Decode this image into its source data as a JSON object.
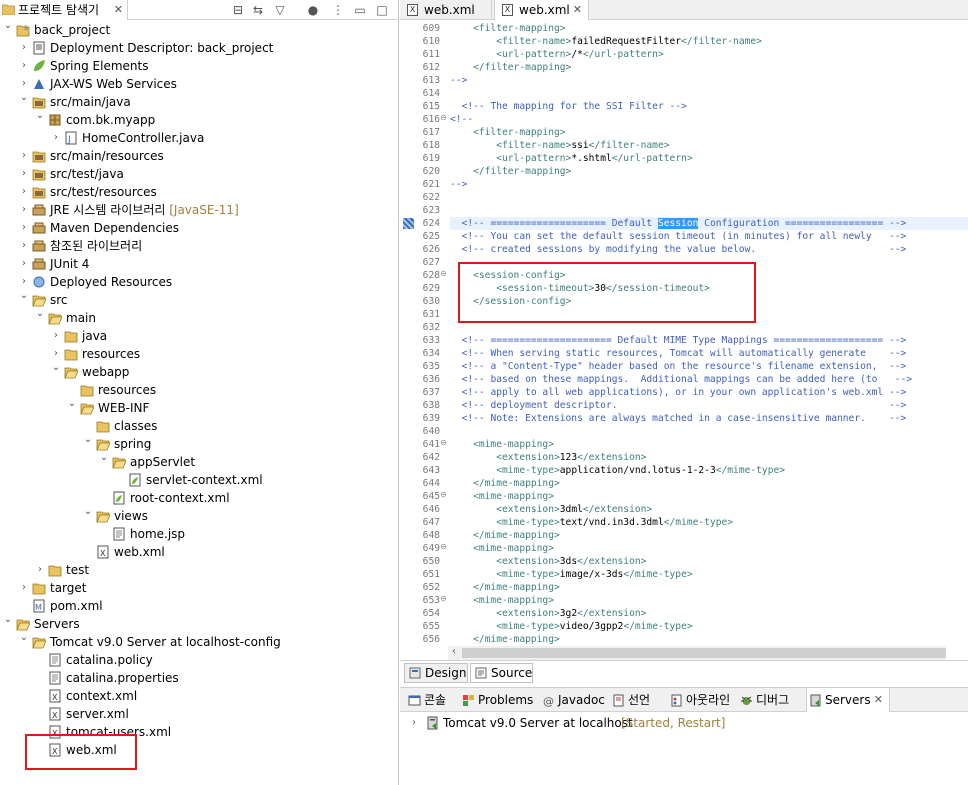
{
  "left_panel": {
    "tab_title": "프로젝트 탐색기",
    "close": "✕",
    "tree": [
      {
        "label": "back_project",
        "decor": ""
      },
      {
        "label": "Deployment Descriptor: back_project",
        "decor": ""
      },
      {
        "label": "Spring Elements",
        "decor": ""
      },
      {
        "label": "JAX-WS Web Services",
        "decor": ""
      },
      {
        "label": "src/main/java",
        "decor": ""
      },
      {
        "label": "com.bk.myapp",
        "decor": ""
      },
      {
        "label": "HomeController.java",
        "decor": ""
      },
      {
        "label": "src/main/resources",
        "decor": ""
      },
      {
        "label": "src/test/java",
        "decor": ""
      },
      {
        "label": "src/test/resources",
        "decor": ""
      },
      {
        "label": "JRE 시스템 라이브러리",
        "decor": "[JavaSE-11]"
      },
      {
        "label": "Maven Dependencies",
        "decor": ""
      },
      {
        "label": "참조된 라이브러리",
        "decor": ""
      },
      {
        "label": "JUnit 4",
        "decor": ""
      },
      {
        "label": "Deployed Resources",
        "decor": ""
      },
      {
        "label": "src",
        "decor": ""
      },
      {
        "label": "main",
        "decor": ""
      },
      {
        "label": "java",
        "decor": ""
      },
      {
        "label": "resources",
        "decor": ""
      },
      {
        "label": "webapp",
        "decor": ""
      },
      {
        "label": "resources",
        "decor": ""
      },
      {
        "label": "WEB-INF",
        "decor": ""
      },
      {
        "label": "classes",
        "decor": ""
      },
      {
        "label": "spring",
        "decor": ""
      },
      {
        "label": "appServlet",
        "decor": ""
      },
      {
        "label": "servlet-context.xml",
        "decor": ""
      },
      {
        "label": "root-context.xml",
        "decor": ""
      },
      {
        "label": "views",
        "decor": ""
      },
      {
        "label": "home.jsp",
        "decor": ""
      },
      {
        "label": "web.xml",
        "decor": ""
      },
      {
        "label": "test",
        "decor": ""
      },
      {
        "label": "target",
        "decor": ""
      },
      {
        "label": "pom.xml",
        "decor": ""
      },
      {
        "label": "Servers",
        "decor": ""
      },
      {
        "label": "Tomcat v9.0 Server at localhost-config",
        "decor": ""
      },
      {
        "label": "catalina.policy",
        "decor": ""
      },
      {
        "label": "catalina.properties",
        "decor": ""
      },
      {
        "label": "context.xml",
        "decor": ""
      },
      {
        "label": "server.xml",
        "decor": ""
      },
      {
        "label": "tomcat-users.xml",
        "decor": ""
      },
      {
        "label": "web.xml",
        "decor": ""
      }
    ]
  },
  "editor": {
    "tabs": [
      {
        "label": "web.xml"
      },
      {
        "label": "web.xml",
        "close": "✕"
      }
    ],
    "lines": [
      {
        "n": "609",
        "t": "    <filter-mapping>"
      },
      {
        "n": "610",
        "t": "        <filter-name>failedRequestFilter</filter-name>"
      },
      {
        "n": "611",
        "t": "        <url-pattern>/*</url-pattern>"
      },
      {
        "n": "612",
        "t": "    </filter-mapping>"
      },
      {
        "n": "613",
        "t": "-->"
      },
      {
        "n": "614",
        "t": ""
      },
      {
        "n": "615",
        "t": "  <!-- The mapping for the SSI Filter -->"
      },
      {
        "n": "616",
        "t": "<!--"
      },
      {
        "n": "617",
        "t": "    <filter-mapping>"
      },
      {
        "n": "618",
        "t": "        <filter-name>ssi</filter-name>"
      },
      {
        "n": "619",
        "t": "        <url-pattern>*.shtml</url-pattern>"
      },
      {
        "n": "620",
        "t": "    </filter-mapping>"
      },
      {
        "n": "621",
        "t": "-->"
      },
      {
        "n": "622",
        "t": ""
      },
      {
        "n": "623",
        "t": ""
      },
      {
        "n": "624",
        "t": "  <!-- ==================== Default Session Configuration ================= -->"
      },
      {
        "n": "625",
        "t": "  <!-- You can set the default session timeout (in minutes) for all newly   -->"
      },
      {
        "n": "626",
        "t": "  <!-- created sessions by modifying the value below.                       -->"
      },
      {
        "n": "627",
        "t": ""
      },
      {
        "n": "628",
        "t": "    <session-config>"
      },
      {
        "n": "629",
        "t": "        <session-timeout>30</session-timeout>"
      },
      {
        "n": "630",
        "t": "    </session-config>"
      },
      {
        "n": "631",
        "t": ""
      },
      {
        "n": "632",
        "t": ""
      },
      {
        "n": "633",
        "t": "  <!-- ===================== Default MIME Type Mappings =================== -->"
      },
      {
        "n": "634",
        "t": "  <!-- When serving static resources, Tomcat will automatically generate    -->"
      },
      {
        "n": "635",
        "t": "  <!-- a \"Content-Type\" header based on the resource's filename extension,  -->"
      },
      {
        "n": "636",
        "t": "  <!-- based on these mappings.  Additional mappings can be added here (to   -->"
      },
      {
        "n": "637",
        "t": "  <!-- apply to all web applications), or in your own application's web.xml -->"
      },
      {
        "n": "638",
        "t": "  <!-- deployment descriptor.                                               -->"
      },
      {
        "n": "639",
        "t": "  <!-- Note: Extensions are always matched in a case-insensitive manner.    -->"
      },
      {
        "n": "640",
        "t": ""
      },
      {
        "n": "641",
        "t": "    <mime-mapping>"
      },
      {
        "n": "642",
        "t": "        <extension>123</extension>"
      },
      {
        "n": "643",
        "t": "        <mime-type>application/vnd.lotus-1-2-3</mime-type>"
      },
      {
        "n": "644",
        "t": "    </mime-mapping>"
      },
      {
        "n": "645",
        "t": "    <mime-mapping>"
      },
      {
        "n": "646",
        "t": "        <extension>3dml</extension>"
      },
      {
        "n": "647",
        "t": "        <mime-type>text/vnd.in3d.3dml</mime-type>"
      },
      {
        "n": "648",
        "t": "    </mime-mapping>"
      },
      {
        "n": "649",
        "t": "    <mime-mapping>"
      },
      {
        "n": "650",
        "t": "        <extension>3ds</extension>"
      },
      {
        "n": "651",
        "t": "        <mime-type>image/x-3ds</mime-type>"
      },
      {
        "n": "652",
        "t": "    </mime-mapping>"
      },
      {
        "n": "653",
        "t": "    <mime-mapping>"
      },
      {
        "n": "654",
        "t": "        <extension>3g2</extension>"
      },
      {
        "n": "655",
        "t": "        <mime-type>video/3gpp2</mime-type>"
      },
      {
        "n": "656",
        "t": "    </mime-mapping>"
      }
    ],
    "bottom_tabs": {
      "design": "Design",
      "source": "Source"
    }
  },
  "console_tabs": [
    {
      "label": "콘솔"
    },
    {
      "label": "Problems"
    },
    {
      "label": "Javadoc"
    },
    {
      "label": "선언"
    },
    {
      "label": "아웃라인"
    },
    {
      "label": "디버그"
    },
    {
      "label": "Servers",
      "close": "✕"
    }
  ],
  "server_entry": {
    "name": "Tomcat v9.0 Server at localhost",
    "status": "[Started, Restart]"
  },
  "colors": {
    "highlight_box": "#e0181b",
    "xml_tag": "#3f7f7f",
    "xml_comment": "#3f5fbf",
    "selection": "#3399ff"
  }
}
